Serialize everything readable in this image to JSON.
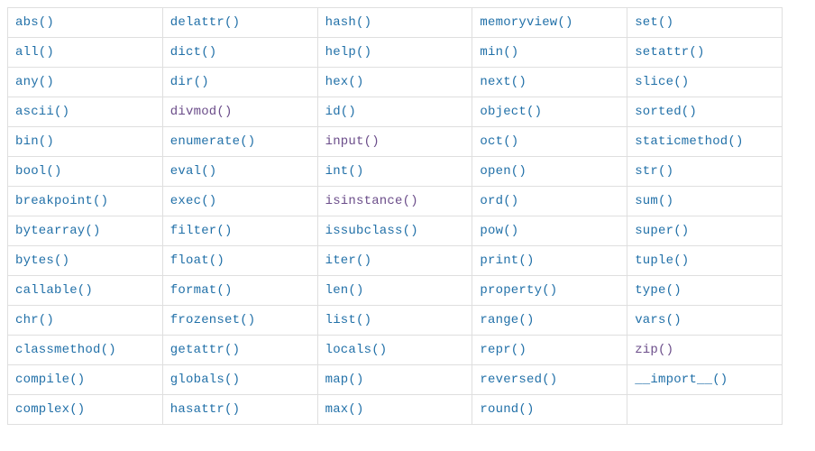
{
  "builtins": {
    "columns": [
      [
        "abs()",
        "all()",
        "any()",
        "ascii()",
        "bin()",
        "bool()",
        "breakpoint()",
        "bytearray()",
        "bytes()",
        "callable()",
        "chr()",
        "classmethod()",
        "compile()",
        "complex()"
      ],
      [
        "delattr()",
        "dict()",
        "dir()",
        "divmod()",
        "enumerate()",
        "eval()",
        "exec()",
        "filter()",
        "float()",
        "format()",
        "frozenset()",
        "getattr()",
        "globals()",
        "hasattr()"
      ],
      [
        "hash()",
        "help()",
        "hex()",
        "id()",
        "input()",
        "int()",
        "isinstance()",
        "issubclass()",
        "iter()",
        "len()",
        "list()",
        "locals()",
        "map()",
        "max()"
      ],
      [
        "memoryview()",
        "min()",
        "next()",
        "object()",
        "oct()",
        "open()",
        "ord()",
        "pow()",
        "print()",
        "property()",
        "range()",
        "repr()",
        "reversed()",
        "round()"
      ],
      [
        "set()",
        "setattr()",
        "slice()",
        "sorted()",
        "staticmethod()",
        "str()",
        "sum()",
        "super()",
        "tuple()",
        "type()",
        "vars()",
        "zip()",
        "__import__()",
        ""
      ]
    ],
    "visited": [
      "divmod()",
      "input()",
      "isinstance()",
      "zip()"
    ]
  }
}
